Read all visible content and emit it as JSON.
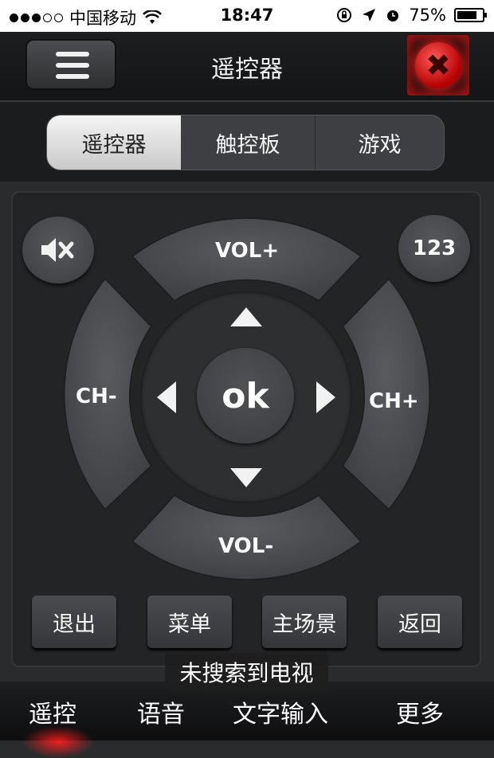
{
  "status_bar": {
    "carrier": "中国移动",
    "time": "18:47",
    "battery": "75%",
    "signal_dots_total": 5,
    "signal_dots_filled": 3
  },
  "header": {
    "title": "遥控器",
    "menu_icon": "hamburger-icon",
    "close_icon": "close-icon",
    "close_color": "#e01010"
  },
  "segments": [
    {
      "label": "遥控器",
      "active": true
    },
    {
      "label": "触控板",
      "active": false
    },
    {
      "label": "游戏",
      "active": false
    }
  ],
  "remote": {
    "mute_icon": "mute-icon",
    "numpad_label": "123",
    "vol_up": "VOL+",
    "vol_down": "VOL-",
    "ch_down": "CH-",
    "ch_up": "CH+",
    "ok": "ok"
  },
  "bottom_buttons": [
    "退出",
    "菜单",
    "主场景",
    "返回"
  ],
  "toast": "未搜索到电视",
  "tabbar": {
    "items": [
      "遥控",
      "语音",
      "文字输入",
      "更多"
    ],
    "active_color": "#ff2020"
  }
}
